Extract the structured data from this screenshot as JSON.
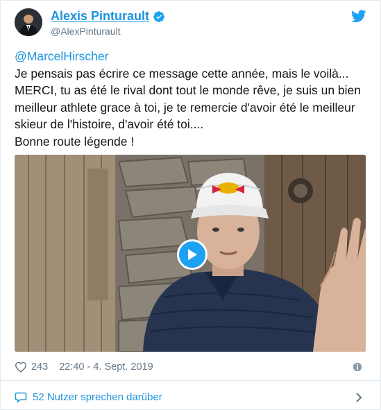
{
  "author": {
    "display_name": "Alexis Pinturault",
    "handle": "@AlexPinturault"
  },
  "tweet": {
    "mention": "@MarcelHirscher",
    "lines": [
      "Je pensais pas écrire ce message cette année, mais le voilà...",
      "MERCI, tu as été le rival dont tout le monde rêve, je suis un bien",
      "meilleur athlete grace à toi, je te remercie d'avoir été le meilleur",
      "skieur de l'histoire, d'avoir été toi....",
      "Bonne route légende !"
    ]
  },
  "media": {
    "cap_logo_text": "Red Bull"
  },
  "meta": {
    "likes": "243",
    "timestamp": "22:40 - 4. Sept. 2019"
  },
  "footer": {
    "talking_label": "52 Nutzer sprechen darüber"
  },
  "colors": {
    "link_blue": "#1c94e0",
    "twitter_blue": "#1da1f2",
    "muted_gray": "#657786",
    "border": "#e1e8ed"
  },
  "icons": [
    "twitter-bird-icon",
    "verified-badge-icon",
    "play-icon",
    "heart-icon",
    "info-icon",
    "chat-bubble-icon",
    "chevron-right-icon"
  ]
}
